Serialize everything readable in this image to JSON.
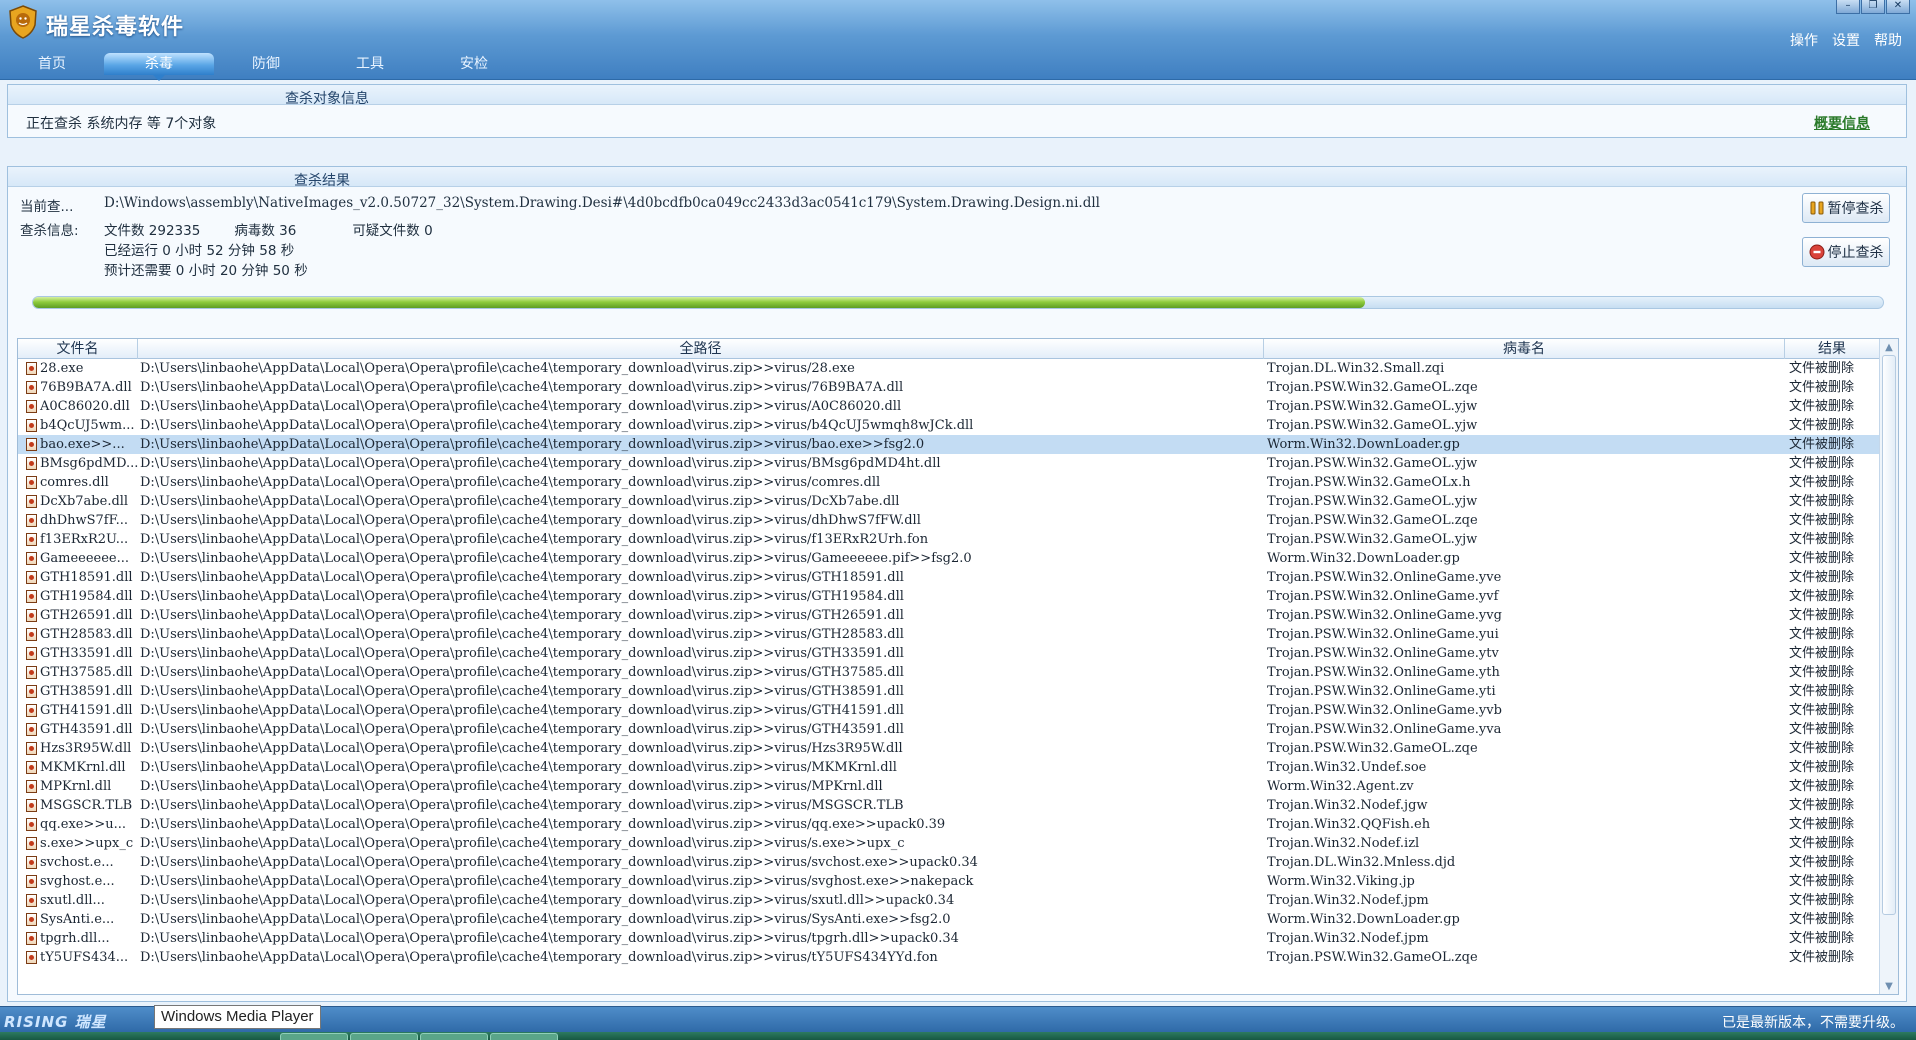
{
  "app": {
    "title": "瑞星杀毒软件",
    "nav_tabs": [
      "首页",
      "杀毒",
      "防御",
      "工具",
      "安检"
    ],
    "active_tab": 1,
    "top_menu": [
      "操作",
      "设置",
      "帮助"
    ]
  },
  "scan_target": {
    "title": "查杀对象信息",
    "scanning_text": "正在查杀  系统内存  等 7个对象",
    "summary_link": "概要信息"
  },
  "scan_result": {
    "title": "查杀结果",
    "current_label": "当前查...",
    "current_path": "D:\\Windows\\assembly\\NativeImages_v2.0.50727_32\\System.Drawing.Desi#\\4d0bcdfb0ca049cc2433d3ac0541c179\\System.Drawing.Design.ni.dll",
    "info_label": "查杀信息:",
    "files_count": "文件数 292335",
    "virus_count": "病毒数 36",
    "suspicious_count": "可疑文件数 0",
    "elapsed": "已经运行 0 小时 52 分钟 58  秒",
    "remaining": "预计还需要 0 小时 20 分钟 50  秒",
    "pause_button": "暂停查杀",
    "stop_button": "停止查杀",
    "progress_fraction": 0.72
  },
  "table": {
    "headers": [
      "文件名",
      "全路径",
      "病毒名",
      "结果"
    ],
    "selected_index": 4,
    "rows": [
      [
        "28.exe",
        "D:\\Users\\linbaohe\\AppData\\Local\\Opera\\Opera\\profile\\cache4\\temporary_download\\virus.zip>>virus/28.exe",
        "Trojan.DL.Win32.Small.zqi",
        "文件被删除"
      ],
      [
        "76B9BA7A.dll",
        "D:\\Users\\linbaohe\\AppData\\Local\\Opera\\Opera\\profile\\cache4\\temporary_download\\virus.zip>>virus/76B9BA7A.dll",
        "Trojan.PSW.Win32.GameOL.zqe",
        "文件被删除"
      ],
      [
        "A0C86020.dll",
        "D:\\Users\\linbaohe\\AppData\\Local\\Opera\\Opera\\profile\\cache4\\temporary_download\\virus.zip>>virus/A0C86020.dll",
        "Trojan.PSW.Win32.GameOL.yjw",
        "文件被删除"
      ],
      [
        "b4QcUJ5wm...",
        "D:\\Users\\linbaohe\\AppData\\Local\\Opera\\Opera\\profile\\cache4\\temporary_download\\virus.zip>>virus/b4QcUJ5wmqh8wJCk.dll",
        "Trojan.PSW.Win32.GameOL.yjw",
        "文件被删除"
      ],
      [
        "bao.exe>>...",
        "D:\\Users\\linbaohe\\AppData\\Local\\Opera\\Opera\\profile\\cache4\\temporary_download\\virus.zip>>virus/bao.exe>>fsg2.0",
        "Worm.Win32.DownLoader.gp",
        "文件被删除"
      ],
      [
        "BMsg6pdMD...",
        "D:\\Users\\linbaohe\\AppData\\Local\\Opera\\Opera\\profile\\cache4\\temporary_download\\virus.zip>>virus/BMsg6pdMD4ht.dll",
        "Trojan.PSW.Win32.GameOL.yjw",
        "文件被删除"
      ],
      [
        "comres.dll",
        "D:\\Users\\linbaohe\\AppData\\Local\\Opera\\Opera\\profile\\cache4\\temporary_download\\virus.zip>>virus/comres.dll",
        "Trojan.PSW.Win32.GameOLx.h",
        "文件被删除"
      ],
      [
        "DcXb7abe.dll",
        "D:\\Users\\linbaohe\\AppData\\Local\\Opera\\Opera\\profile\\cache4\\temporary_download\\virus.zip>>virus/DcXb7abe.dll",
        "Trojan.PSW.Win32.GameOL.yjw",
        "文件被删除"
      ],
      [
        "dhDhwS7fF...",
        "D:\\Users\\linbaohe\\AppData\\Local\\Opera\\Opera\\profile\\cache4\\temporary_download\\virus.zip>>virus/dhDhwS7fFW.dll",
        "Trojan.PSW.Win32.GameOL.zqe",
        "文件被删除"
      ],
      [
        "f13ERxR2U...",
        "D:\\Users\\linbaohe\\AppData\\Local\\Opera\\Opera\\profile\\cache4\\temporary_download\\virus.zip>>virus/f13ERxR2Urh.fon",
        "Trojan.PSW.Win32.GameOL.yjw",
        "文件被删除"
      ],
      [
        "Gameeeeee...",
        "D:\\Users\\linbaohe\\AppData\\Local\\Opera\\Opera\\profile\\cache4\\temporary_download\\virus.zip>>virus/Gameeeeee.pif>>fsg2.0",
        "Worm.Win32.DownLoader.gp",
        "文件被删除"
      ],
      [
        "GTH18591.dll",
        "D:\\Users\\linbaohe\\AppData\\Local\\Opera\\Opera\\profile\\cache4\\temporary_download\\virus.zip>>virus/GTH18591.dll",
        "Trojan.PSW.Win32.OnlineGame.yve",
        "文件被删除"
      ],
      [
        "GTH19584.dll",
        "D:\\Users\\linbaohe\\AppData\\Local\\Opera\\Opera\\profile\\cache4\\temporary_download\\virus.zip>>virus/GTH19584.dll",
        "Trojan.PSW.Win32.OnlineGame.yvf",
        "文件被删除"
      ],
      [
        "GTH26591.dll",
        "D:\\Users\\linbaohe\\AppData\\Local\\Opera\\Opera\\profile\\cache4\\temporary_download\\virus.zip>>virus/GTH26591.dll",
        "Trojan.PSW.Win32.OnlineGame.yvg",
        "文件被删除"
      ],
      [
        "GTH28583.dll",
        "D:\\Users\\linbaohe\\AppData\\Local\\Opera\\Opera\\profile\\cache4\\temporary_download\\virus.zip>>virus/GTH28583.dll",
        "Trojan.PSW.Win32.OnlineGame.yui",
        "文件被删除"
      ],
      [
        "GTH33591.dll",
        "D:\\Users\\linbaohe\\AppData\\Local\\Opera\\Opera\\profile\\cache4\\temporary_download\\virus.zip>>virus/GTH33591.dll",
        "Trojan.PSW.Win32.OnlineGame.ytv",
        "文件被删除"
      ],
      [
        "GTH37585.dll",
        "D:\\Users\\linbaohe\\AppData\\Local\\Opera\\Opera\\profile\\cache4\\temporary_download\\virus.zip>>virus/GTH37585.dll",
        "Trojan.PSW.Win32.OnlineGame.yth",
        "文件被删除"
      ],
      [
        "GTH38591.dll",
        "D:\\Users\\linbaohe\\AppData\\Local\\Opera\\Opera\\profile\\cache4\\temporary_download\\virus.zip>>virus/GTH38591.dll",
        "Trojan.PSW.Win32.OnlineGame.yti",
        "文件被删除"
      ],
      [
        "GTH41591.dll",
        "D:\\Users\\linbaohe\\AppData\\Local\\Opera\\Opera\\profile\\cache4\\temporary_download\\virus.zip>>virus/GTH41591.dll",
        "Trojan.PSW.Win32.OnlineGame.yvb",
        "文件被删除"
      ],
      [
        "GTH43591.dll",
        "D:\\Users\\linbaohe\\AppData\\Local\\Opera\\Opera\\profile\\cache4\\temporary_download\\virus.zip>>virus/GTH43591.dll",
        "Trojan.PSW.Win32.OnlineGame.yva",
        "文件被删除"
      ],
      [
        "Hzs3R95W.dll",
        "D:\\Users\\linbaohe\\AppData\\Local\\Opera\\Opera\\profile\\cache4\\temporary_download\\virus.zip>>virus/Hzs3R95W.dll",
        "Trojan.PSW.Win32.GameOL.zqe",
        "文件被删除"
      ],
      [
        "MKMKrnl.dll",
        "D:\\Users\\linbaohe\\AppData\\Local\\Opera\\Opera\\profile\\cache4\\temporary_download\\virus.zip>>virus/MKMKrnl.dll",
        "Trojan.Win32.Undef.soe",
        "文件被删除"
      ],
      [
        "MPKrnl.dll",
        "D:\\Users\\linbaohe\\AppData\\Local\\Opera\\Opera\\profile\\cache4\\temporary_download\\virus.zip>>virus/MPKrnl.dll",
        "Worm.Win32.Agent.zv",
        "文件被删除"
      ],
      [
        "MSGSCR.TLB",
        "D:\\Users\\linbaohe\\AppData\\Local\\Opera\\Opera\\profile\\cache4\\temporary_download\\virus.zip>>virus/MSGSCR.TLB",
        "Trojan.Win32.Nodef.jgw",
        "文件被删除"
      ],
      [
        "qq.exe>>u...",
        "D:\\Users\\linbaohe\\AppData\\Local\\Opera\\Opera\\profile\\cache4\\temporary_download\\virus.zip>>virus/qq.exe>>upack0.39",
        "Trojan.Win32.QQFish.eh",
        "文件被删除"
      ],
      [
        "s.exe>>upx_c",
        "D:\\Users\\linbaohe\\AppData\\Local\\Opera\\Opera\\profile\\cache4\\temporary_download\\virus.zip>>virus/s.exe>>upx_c",
        "Trojan.Win32.Nodef.izl",
        "文件被删除"
      ],
      [
        "svchost.e...",
        "D:\\Users\\linbaohe\\AppData\\Local\\Opera\\Opera\\profile\\cache4\\temporary_download\\virus.zip>>virus/svchost.exe>>upack0.34",
        "Trojan.DL.Win32.Mnless.djd",
        "文件被删除"
      ],
      [
        "svghost.e...",
        "D:\\Users\\linbaohe\\AppData\\Local\\Opera\\Opera\\profile\\cache4\\temporary_download\\virus.zip>>virus/svghost.exe>>nakepack",
        "Worm.Win32.Viking.jp",
        "文件被删除"
      ],
      [
        "sxutl.dll...",
        "D:\\Users\\linbaohe\\AppData\\Local\\Opera\\Opera\\profile\\cache4\\temporary_download\\virus.zip>>virus/sxutl.dll>>upack0.34",
        "Trojan.Win32.Nodef.jpm",
        "文件被删除"
      ],
      [
        "SysAnti.e...",
        "D:\\Users\\linbaohe\\AppData\\Local\\Opera\\Opera\\profile\\cache4\\temporary_download\\virus.zip>>virus/SysAnti.exe>>fsg2.0",
        "Worm.Win32.DownLoader.gp",
        "文件被删除"
      ],
      [
        "tpgrh.dll...",
        "D:\\Users\\linbaohe\\AppData\\Local\\Opera\\Opera\\profile\\cache4\\temporary_download\\virus.zip>>virus/tpgrh.dll>>upack0.34",
        "Trojan.Win32.Nodef.jpm",
        "文件被删除"
      ],
      [
        "tY5UFS434...",
        "D:\\Users\\linbaohe\\AppData\\Local\\Opera\\Opera\\profile\\cache4\\temporary_download\\virus.zip>>virus/tY5UFS434YYd.fon",
        "Trojan.PSW.Win32.GameOL.zqe",
        "文件被删除"
      ]
    ]
  },
  "footer": {
    "brand": "RISING 瑞星",
    "tooltip": "Windows Media Player",
    "update_status": "已是最新版本，不需要升级。"
  },
  "colors": {
    "title_bar": "#4f8dc9",
    "selected_row": "#c3dcf3",
    "progress": "#8fcc3d",
    "link_green": "#2a7a2a"
  }
}
